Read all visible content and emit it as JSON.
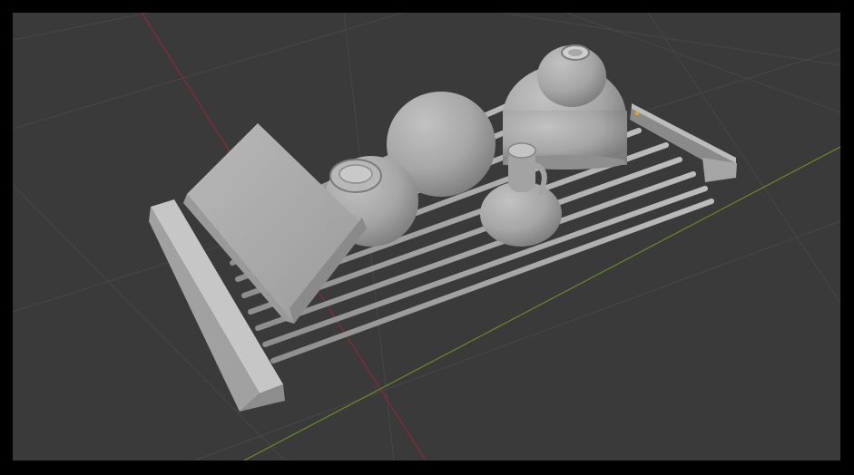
{
  "viewport": {
    "background": "#3a3a3a",
    "frame_color": "#000000",
    "grid_color": "#484848",
    "x_axis_color": "#8a2a36",
    "y_axis_color": "#6c8a28"
  },
  "scene": {
    "objects": [
      "dish-rack",
      "cutting-board",
      "bowl-with-cup",
      "inverted-bowl",
      "stacked-bowls",
      "mug"
    ],
    "material_color": "#a3a3a3"
  },
  "origin_marker_color": "#e8a020"
}
